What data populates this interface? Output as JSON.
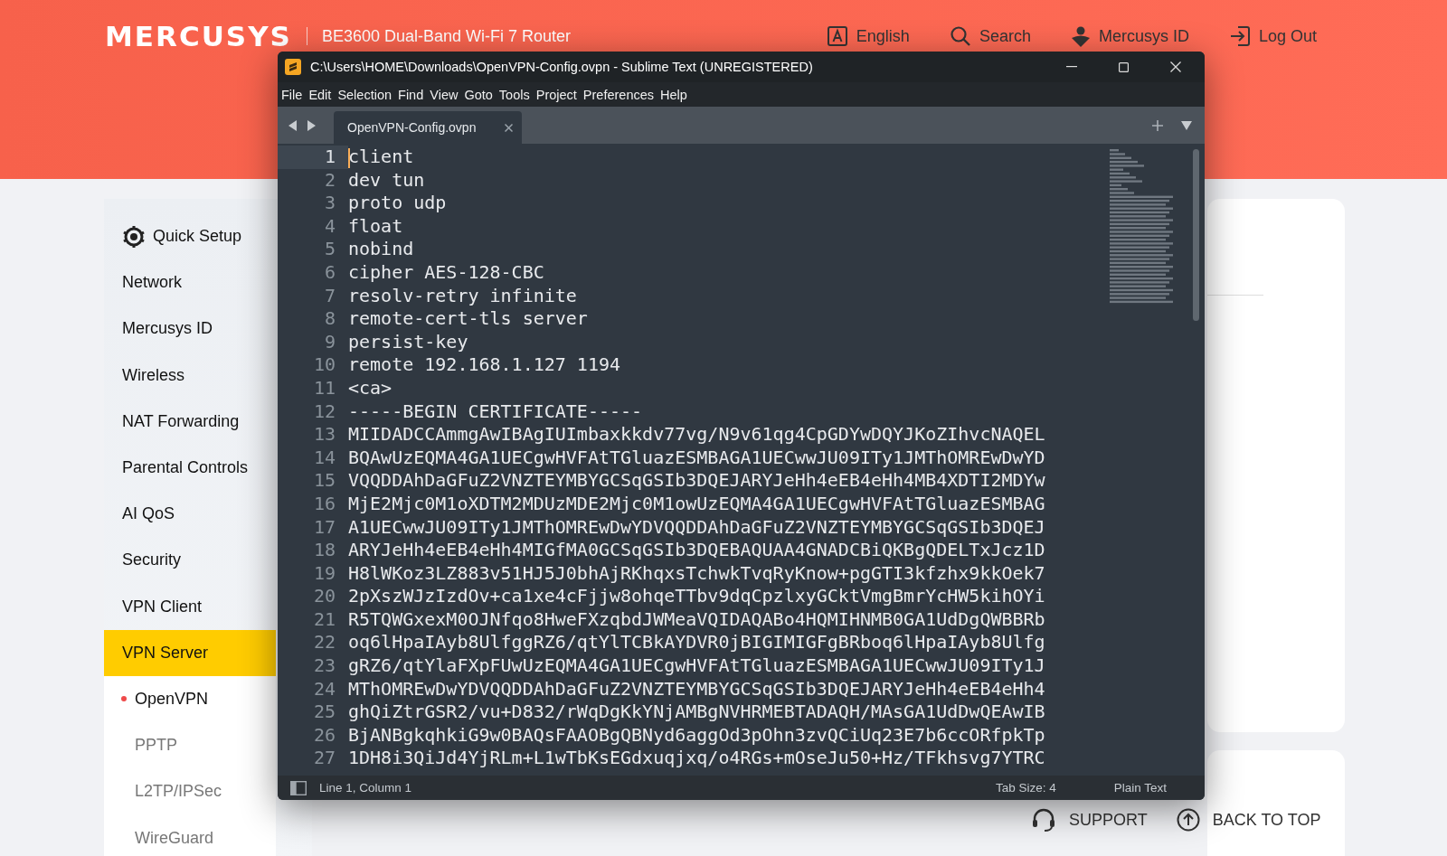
{
  "header": {
    "logo": "MERCUSYS",
    "product": "BE3600 Dual-Band Wi-Fi 7 Router",
    "links": [
      {
        "label": "English",
        "kind": "language"
      },
      {
        "label": "Search",
        "kind": "search"
      },
      {
        "label": "Mercusys ID",
        "kind": "account"
      },
      {
        "label": "Log Out",
        "kind": "logout"
      }
    ]
  },
  "sidebar": {
    "items": [
      {
        "label": "Quick Setup",
        "kind": "setup",
        "selected": false
      },
      {
        "label": "Network",
        "kind": "item",
        "selected": false
      },
      {
        "label": "Mercusys ID",
        "kind": "item",
        "selected": false
      },
      {
        "label": "Wireless",
        "kind": "item",
        "selected": false
      },
      {
        "label": "NAT Forwarding",
        "kind": "item",
        "selected": false
      },
      {
        "label": "Parental Controls",
        "kind": "item",
        "selected": false
      },
      {
        "label": "AI QoS",
        "kind": "item",
        "selected": false
      },
      {
        "label": "Security",
        "kind": "item",
        "selected": false
      },
      {
        "label": "VPN Client",
        "kind": "item",
        "selected": false
      },
      {
        "label": "VPN Server",
        "kind": "item",
        "selected": true,
        "children": [
          {
            "label": "OpenVPN",
            "selected": true
          },
          {
            "label": "PPTP",
            "selected": false
          },
          {
            "label": "L2TP/IPSec",
            "selected": false
          },
          {
            "label": "WireGuard",
            "selected": false
          }
        ]
      }
    ]
  },
  "editor_window": {
    "title": "C:\\Users\\HOME\\Downloads\\OpenVPN-Config.ovpn - Sublime Text (UNREGISTERED)",
    "menu": [
      "File",
      "Edit",
      "Selection",
      "Find",
      "View",
      "Goto",
      "Tools",
      "Project",
      "Preferences",
      "Help"
    ],
    "tabs": [
      {
        "label": "OpenVPN-Config.ovpn",
        "selected": true
      }
    ],
    "lines": [
      {
        "number": "1",
        "text": "client",
        "selected": true
      },
      {
        "number": "2",
        "text": "dev tun",
        "selected": false
      },
      {
        "number": "3",
        "text": "proto udp",
        "selected": false
      },
      {
        "number": "4",
        "text": "float",
        "selected": false
      },
      {
        "number": "5",
        "text": "nobind",
        "selected": false
      },
      {
        "number": "6",
        "text": "cipher AES-128-CBC",
        "selected": false
      },
      {
        "number": "7",
        "text": "resolv-retry infinite",
        "selected": false
      },
      {
        "number": "8",
        "text": "remote-cert-tls server",
        "selected": false
      },
      {
        "number": "9",
        "text": "persist-key",
        "selected": false
      },
      {
        "number": "10",
        "text": "remote 192.168.1.127 1194",
        "selected": false
      },
      {
        "number": "11",
        "text": "<ca>",
        "selected": false
      },
      {
        "number": "12",
        "text": "-----BEGIN CERTIFICATE-----",
        "selected": false
      },
      {
        "number": "13",
        "text": "MIIDADCCAmmgAwIBAgIUImbaxkkdv77vg/N9v61qg4CpGDYwDQYJKoZIhvcNAQEL",
        "selected": false
      },
      {
        "number": "14",
        "text": "BQAwUzEQMA4GA1UECgwHVFAtTGluazESMBAGA1UECwwJU09ITy1JMThOMREwDwYD",
        "selected": false
      },
      {
        "number": "15",
        "text": "VQQDDAhDaGFuZ2VNZTEYMBYGCSqGSIb3DQEJARYJeHh4eEB4eHh4MB4XDTI2MDYw",
        "selected": false
      },
      {
        "number": "16",
        "text": "MjE2Mjc0M1oXDTM2MDUzMDE2Mjc0M1owUzEQMA4GA1UECgwHVFAtTGluazESMBAG",
        "selected": false
      },
      {
        "number": "17",
        "text": "A1UECwwJU09ITy1JMThOMREwDwYDVQQDDAhDaGFuZ2VNZTEYMBYGCSqGSIb3DQEJ",
        "selected": false
      },
      {
        "number": "18",
        "text": "ARYJeHh4eEB4eHh4MIGfMA0GCSqGSIb3DQEBAQUAA4GNADCBiQKBgQDELTxJcz1D",
        "selected": false
      },
      {
        "number": "19",
        "text": "H8lWKoz3LZ883v51HJ5J0bhAjRKhqxsTchwkTvqRyKnow+pgGTI3kfzhx9kkOek7",
        "selected": false
      },
      {
        "number": "20",
        "text": "2pXszWJzIzdOv+ca1xe4cFjjw8ohqeTTbv9dqCpzlxyGCktVmgBmrYcHW5kihOYi",
        "selected": false
      },
      {
        "number": "21",
        "text": "R5TQWGxexM0OJNfqo8HweFXzqbdJWMeaVQIDAQABo4HQMIHNMB0GA1UdDgQWBBRb",
        "selected": false
      },
      {
        "number": "22",
        "text": "oq6lHpaIAyb8UlfggRZ6/qtYlTCBkAYDVR0jBIGIMIGFgBRboq6lHpaIAyb8Ulfg",
        "selected": false
      },
      {
        "number": "23",
        "text": "gRZ6/qtYlaFXpFUwUzEQMA4GA1UECgwHVFAtTGluazESMBAGA1UECwwJU09ITy1J",
        "selected": false
      },
      {
        "number": "24",
        "text": "MThOMREwDwYDVQQDDAhDaGFuZ2VNZTEYMBYGCSqGSIb3DQEJARYJeHh4eEB4eHh4",
        "selected": false
      },
      {
        "number": "25",
        "text": "ghQiZtrGSR2/vu+D832/rWqDgKkYNjAMBgNVHRMEBTADAQH/MAsGA1UdDwQEAwIB",
        "selected": false
      },
      {
        "number": "26",
        "text": "BjANBgkqhkiG9w0BAQsFAAOBgQBNyd6aggOd3pOhn3zvQCiUq23E7b6ccORfpkTp",
        "selected": false
      },
      {
        "number": "27",
        "text": "1DH8i3QiJd4YjRLm+L1wTbKsEGdxuqjxq/o4RGs+mOseJu50+Hz/TFkhsvg7YTRC",
        "selected": false
      }
    ],
    "status": {
      "position": "Line 1, Column 1",
      "tab_size": "Tab Size: 4",
      "syntax": "Plain Text"
    }
  },
  "footer": [
    {
      "label": "SUPPORT",
      "kind": "support"
    },
    {
      "label": "BACK TO TOP",
      "kind": "top"
    }
  ]
}
